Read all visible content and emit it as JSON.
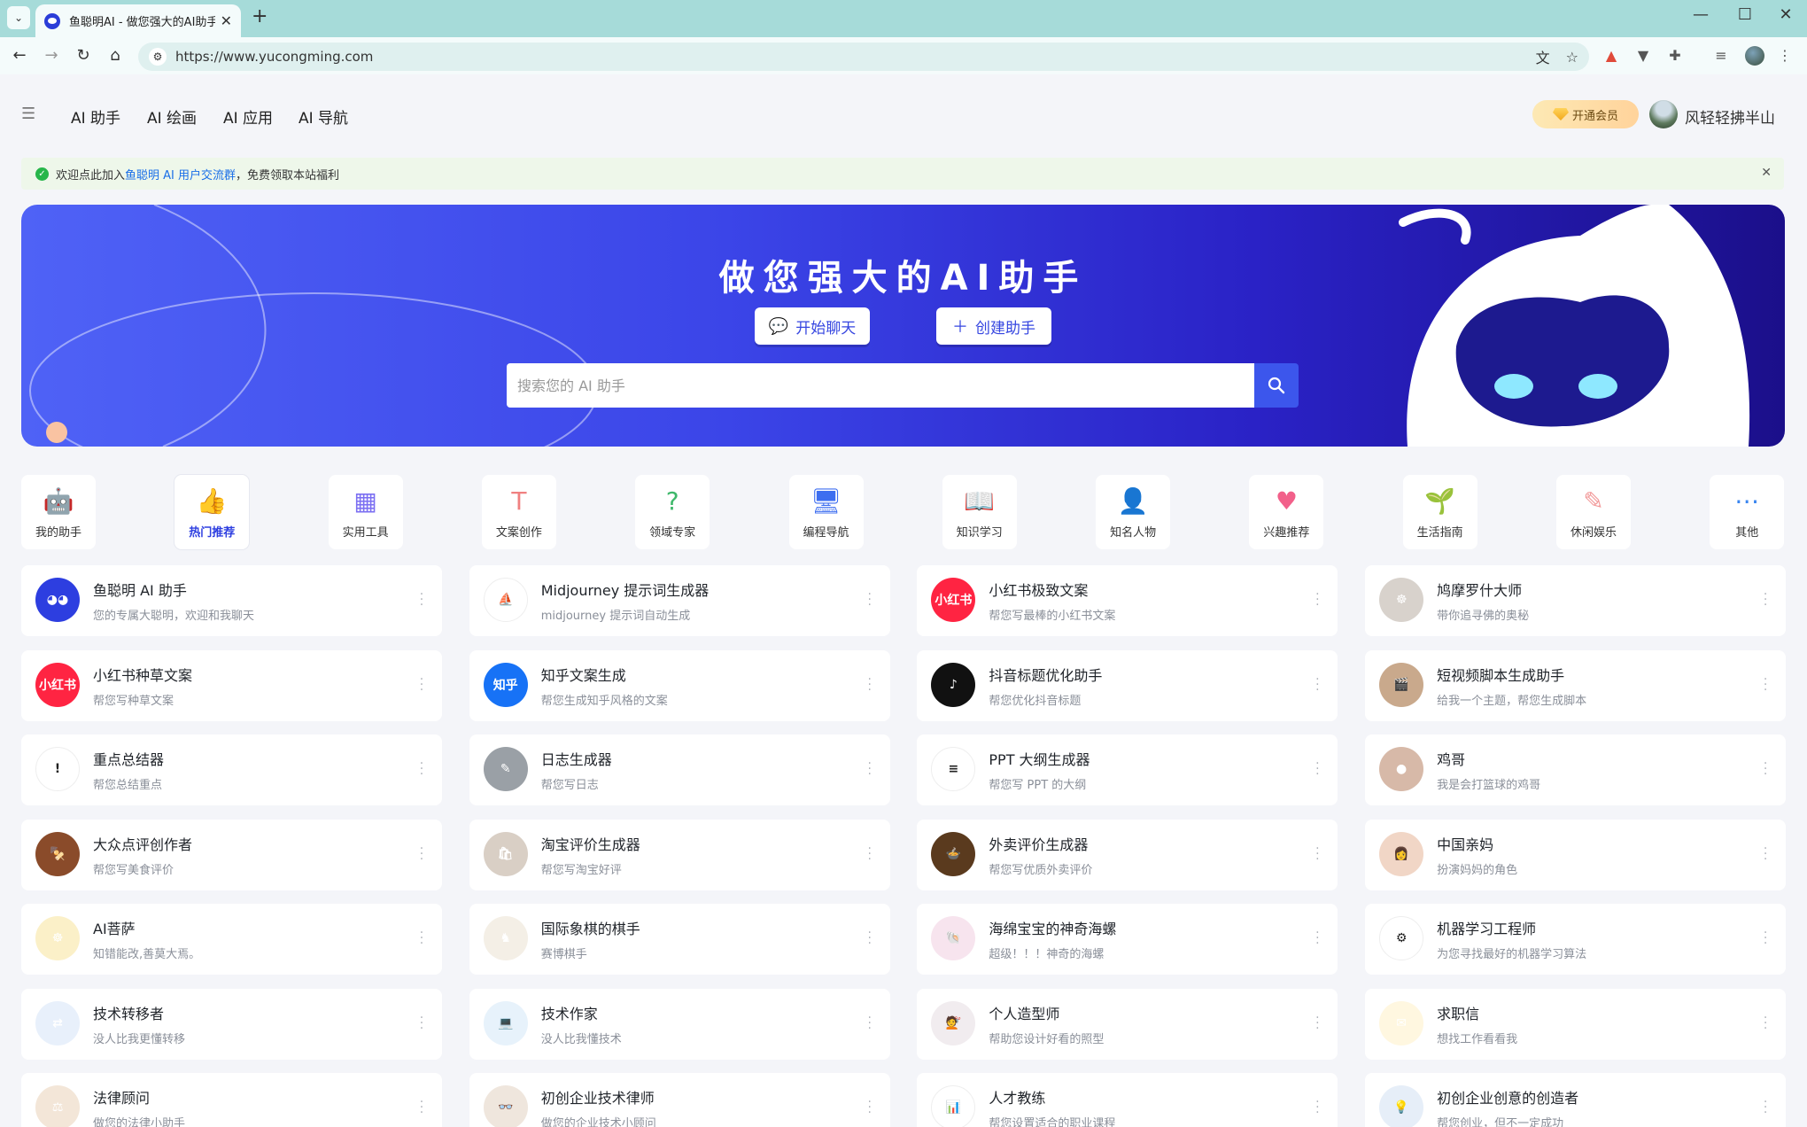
{
  "browser": {
    "tab_title": "鱼聪明AI - 做您强大的AI助手",
    "url": "https://www.yucongming.com"
  },
  "nav": {
    "items": [
      "AI 助手",
      "AI 绘画",
      "AI 应用",
      "AI 导航"
    ],
    "vip_label": "开通会员",
    "username": "风轻轻拂半山"
  },
  "notice": {
    "prefix": "欢迎点此加入",
    "link": "鱼聪明 AI 用户交流群",
    "suffix": "，免费领取本站福利"
  },
  "banner": {
    "title": "做您强大的AI助手",
    "start_chat": "开始聊天",
    "create_assistant": "创建助手",
    "search_placeholder": "搜索您的 AI 助手"
  },
  "categories": [
    {
      "label": "我的助手",
      "icon": "robot-icon",
      "color": "#3b6fe0"
    },
    {
      "label": "热门推荐",
      "icon": "thumbs-up-icon",
      "color": "#f0506a",
      "active": true
    },
    {
      "label": "实用工具",
      "icon": "apps-icon",
      "color": "#7b6ff2"
    },
    {
      "label": "文案创作",
      "icon": "text-icon",
      "color": "#f08080"
    },
    {
      "label": "领域专家",
      "icon": "expert-chat-icon",
      "color": "#3fb86b"
    },
    {
      "label": "编程导航",
      "icon": "monitor-icon",
      "color": "#3d6ef0"
    },
    {
      "label": "知识学习",
      "icon": "book-icon",
      "color": "#f5b62a"
    },
    {
      "label": "知名人物",
      "icon": "person-icon",
      "color": "#5c7cf2"
    },
    {
      "label": "兴趣推荐",
      "icon": "heart-icon",
      "color": "#f2608a"
    },
    {
      "label": "生活指南",
      "icon": "plant-icon",
      "color": "#4cb85c"
    },
    {
      "label": "休闲娱乐",
      "icon": "brush-icon",
      "color": "#f29a9a"
    },
    {
      "label": "其他",
      "icon": "share-icon",
      "color": "#3a86f0"
    }
  ],
  "assistants": [
    {
      "title": "鱼聪明 AI 助手",
      "desc": "您的专属大聪明，欢迎和我聊天",
      "avatar": "robot-avatar",
      "bg": "#2d3ee0",
      "mark": "◕◕"
    },
    {
      "title": "Midjourney 提示词生成器",
      "desc": "midjourney 提示词自动生成",
      "avatar": "sailboat-avatar",
      "bg": "#ffffff",
      "mark": "⛵"
    },
    {
      "title": "小红书极致文案",
      "desc": "帮您写最棒的小红书文案",
      "avatar": "xiaohongshu-avatar",
      "bg": "#ff2442",
      "mark": "小红书"
    },
    {
      "title": "鸠摩罗什大师",
      "desc": "带你追寻佛的奥秘",
      "avatar": "monk-avatar",
      "bg": "#d8d2cc",
      "mark": "☸"
    },
    {
      "title": "小红书种草文案",
      "desc": "帮您写种草文案",
      "avatar": "xiaohongshu-avatar",
      "bg": "#ff2442",
      "mark": "小红书"
    },
    {
      "title": "知乎文案生成",
      "desc": "帮您生成知乎风格的文案",
      "avatar": "zhihu-avatar",
      "bg": "#1772f6",
      "mark": "知乎"
    },
    {
      "title": "抖音标题优化助手",
      "desc": "帮您优化抖音标题",
      "avatar": "douyin-avatar",
      "bg": "#111111",
      "mark": "♪"
    },
    {
      "title": "短视频脚本生成助手",
      "desc": "给我一个主题，帮您生成脚本",
      "avatar": "camera-avatar",
      "bg": "#c9a98c",
      "mark": "🎬"
    },
    {
      "title": "重点总结器",
      "desc": "帮您总结重点",
      "avatar": "exclamation-avatar",
      "bg": "#ffffff",
      "mark": "!"
    },
    {
      "title": "日志生成器",
      "desc": "帮您写日志",
      "avatar": "notebook-avatar",
      "bg": "#9aa0a6",
      "mark": "✎"
    },
    {
      "title": "PPT 大纲生成器",
      "desc": "帮您写 PPT 的大纲",
      "avatar": "ppt-avatar",
      "bg": "#ffffff",
      "mark": "≡"
    },
    {
      "title": "鸡哥",
      "desc": "我是会打篮球的鸡哥",
      "avatar": "basketball-avatar",
      "bg": "#d7b9a8",
      "mark": "●"
    },
    {
      "title": "大众点评创作者",
      "desc": "帮您写美食评价",
      "avatar": "food-avatar",
      "bg": "#8a4b2a",
      "mark": "🍢"
    },
    {
      "title": "淘宝评价生成器",
      "desc": "帮您写淘宝好评",
      "avatar": "shopping-avatar",
      "bg": "#d9cfc5",
      "mark": "🛍"
    },
    {
      "title": "外卖评价生成器",
      "desc": "帮您写优质外卖评价",
      "avatar": "takeout-avatar",
      "bg": "#5a3a1e",
      "mark": "🍲"
    },
    {
      "title": "中国亲妈",
      "desc": "扮演妈妈的角色",
      "avatar": "mom-avatar",
      "bg": "#f1d6c6",
      "mark": "👩"
    },
    {
      "title": "AI菩萨",
      "desc": "知错能改,善莫大焉。",
      "avatar": "bodhisattva-avatar",
      "bg": "#fbf0c8",
      "mark": "☸"
    },
    {
      "title": "国际象棋的棋手",
      "desc": "赛博棋手",
      "avatar": "chess-avatar",
      "bg": "#f4efe6",
      "mark": "♞"
    },
    {
      "title": "海绵宝宝的神奇海螺",
      "desc": "超级！！！神奇的海螺",
      "avatar": "conch-avatar",
      "bg": "#f7e4ee",
      "mark": "🐚"
    },
    {
      "title": "机器学习工程师",
      "desc": "为您寻找最好的机器学习算法",
      "avatar": "gears-avatar",
      "bg": "#ffffff",
      "mark": "⚙"
    },
    {
      "title": "技术转移者",
      "desc": "没人比我更懂转移",
      "avatar": "transfer-avatar",
      "bg": "#e8f0fb",
      "mark": "⇄"
    },
    {
      "title": "技术作家",
      "desc": "没人比我懂技术",
      "avatar": "writer-avatar",
      "bg": "#e7f2fb",
      "mark": "💻"
    },
    {
      "title": "个人造型师",
      "desc": "帮助您设计好看的照型",
      "avatar": "stylist-avatar",
      "bg": "#f1ecef",
      "mark": "💇"
    },
    {
      "title": "求职信",
      "desc": "想找工作看看我",
      "avatar": "letter-avatar",
      "bg": "#fff7e0",
      "mark": "✉"
    },
    {
      "title": "法律顾问",
      "desc": "做您的法律小助手",
      "avatar": "judge-avatar",
      "bg": "#f3e6d8",
      "mark": "⚖"
    },
    {
      "title": "初创企业技术律师",
      "desc": "做您的企业技术小顾问",
      "avatar": "lawyer-avatar",
      "bg": "#efe6dd",
      "mark": "👓"
    },
    {
      "title": "人才教练",
      "desc": "帮您设置适合的职业课程",
      "avatar": "coach-avatar",
      "bg": "#ffffff",
      "mark": "📊"
    },
    {
      "title": "初创企业创意的创造者",
      "desc": "帮您创业，但不一定成功",
      "avatar": "founder-avatar",
      "bg": "#e6eef8",
      "mark": "💡"
    }
  ]
}
